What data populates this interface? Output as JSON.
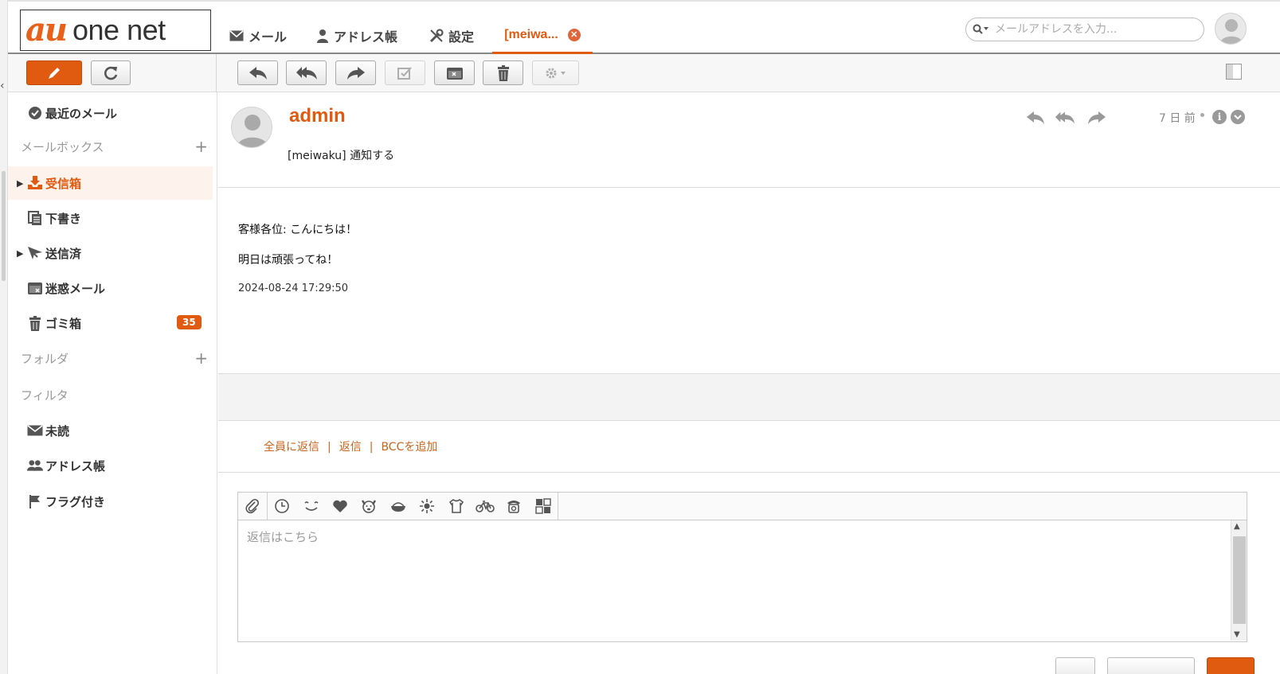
{
  "brand": {
    "logo_mark": "au",
    "logo_text": "one net",
    "accent_color": "#e05a10"
  },
  "nav": {
    "tabs": [
      {
        "label": "メール",
        "icon": "envelope-icon"
      },
      {
        "label": "アドレス帳",
        "icon": "person-icon"
      },
      {
        "label": "設定",
        "icon": "tools-icon"
      },
      {
        "label": "[meiwa...",
        "icon": "close-circle-icon",
        "active": true
      }
    ]
  },
  "search": {
    "placeholder": "メールアドレスを入力..."
  },
  "toolbar": {
    "left_buttons": [
      "compose-pencil-icon",
      "refresh-icon"
    ],
    "message_buttons": [
      "reply-icon",
      "reply-all-icon",
      "forward-icon",
      "mark-read-icon",
      "archive-icon",
      "trash-icon",
      "gear-icon"
    ]
  },
  "sidebar": {
    "recent": "最近のメール",
    "mailbox_header": "メールボックス",
    "mailboxes": [
      {
        "label": "受信箱",
        "icon": "inbox-icon",
        "selected": true
      },
      {
        "label": "下書き",
        "icon": "drafts-icon"
      },
      {
        "label": "送信済",
        "icon": "sent-icon"
      },
      {
        "label": "迷惑メール",
        "icon": "spam-icon"
      },
      {
        "label": "ゴミ箱",
        "icon": "trash-icon",
        "badge": "35"
      }
    ],
    "folder_header": "フォルダ",
    "filter_header": "フィルタ",
    "filters": [
      {
        "label": "未読",
        "icon": "envelope-icon"
      },
      {
        "label": "アドレス帳",
        "icon": "people-icon"
      },
      {
        "label": "フラグ付き",
        "icon": "flag-icon"
      }
    ]
  },
  "message": {
    "sender": "admin",
    "subject": "[meiwaku] 通知する",
    "date_ago": "7 日 前",
    "body_lines": [
      "客様各位: こんにちは！",
      "明日は頑張ってね！",
      "2024-08-24 17:29:50"
    ]
  },
  "reply": {
    "links": [
      "全員に返信",
      "返信",
      "BCCを追加"
    ],
    "separator": "|",
    "placeholder": "返信はこちら",
    "emoji_icons": [
      "clock-icon",
      "smile-icon",
      "heart-icon",
      "dog-icon",
      "rice-bowl-icon",
      "sun-icon",
      "shirt-icon",
      "bicycle-icon",
      "phone-icon",
      "grid-icon"
    ]
  }
}
